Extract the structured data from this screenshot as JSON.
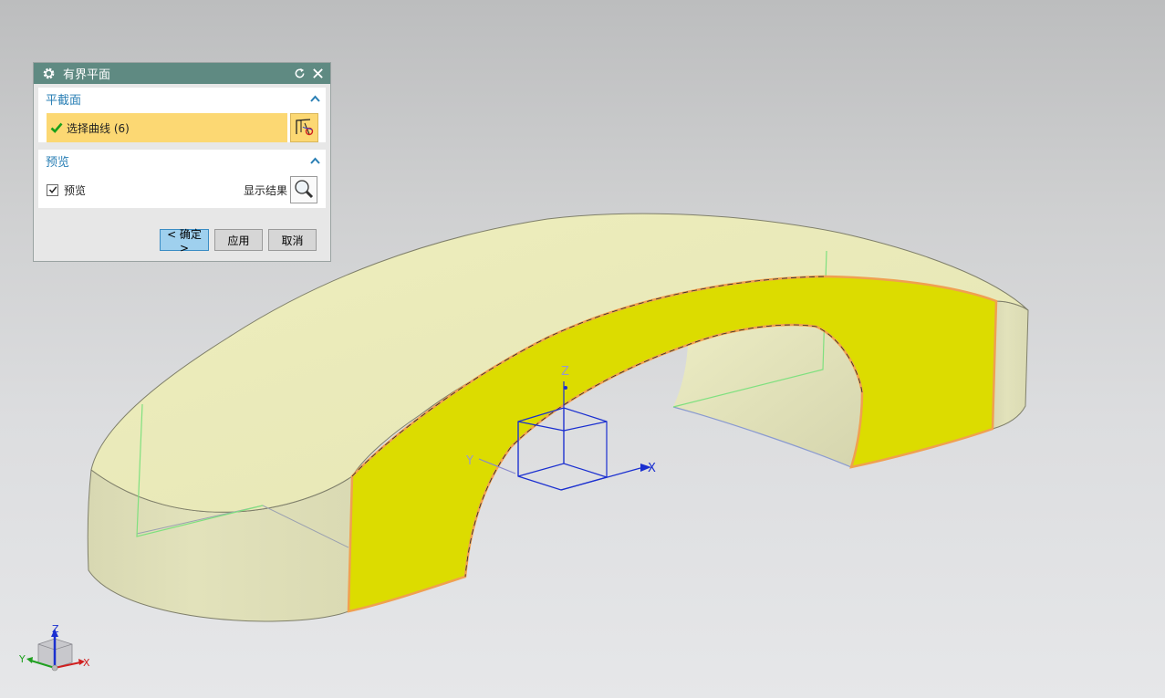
{
  "dialog": {
    "title": "有界平面",
    "icons": {
      "settings": "gear-icon",
      "reset": "reset-icon",
      "close": "close-icon"
    },
    "section1": {
      "title": "平截面",
      "select_label": "选择曲线 (6)",
      "select_icon": "select-curve-icon"
    },
    "section2": {
      "title": "预览",
      "preview_label": "预览",
      "preview_checked": true,
      "show_result_label": "显示结果",
      "show_result_icon": "magnifier-icon"
    },
    "buttons": {
      "ok": "< 确定 >",
      "apply": "应用",
      "cancel": "取消"
    }
  },
  "csys": {
    "x_label": "X",
    "y_label": "Y",
    "z_label": "Z"
  },
  "triad": {
    "x_label": "X",
    "y_label": "Y",
    "z_label": "Z"
  },
  "colors": {
    "titlebar": "#5f8a82",
    "accent_text": "#2a7fb5",
    "selection": "#fcd873",
    "solid_face": "#e8e8b8",
    "bounded_plane": "#dcdc00",
    "edge_highlight": "#f0a050",
    "csys_blue": "#1a2fd0"
  }
}
